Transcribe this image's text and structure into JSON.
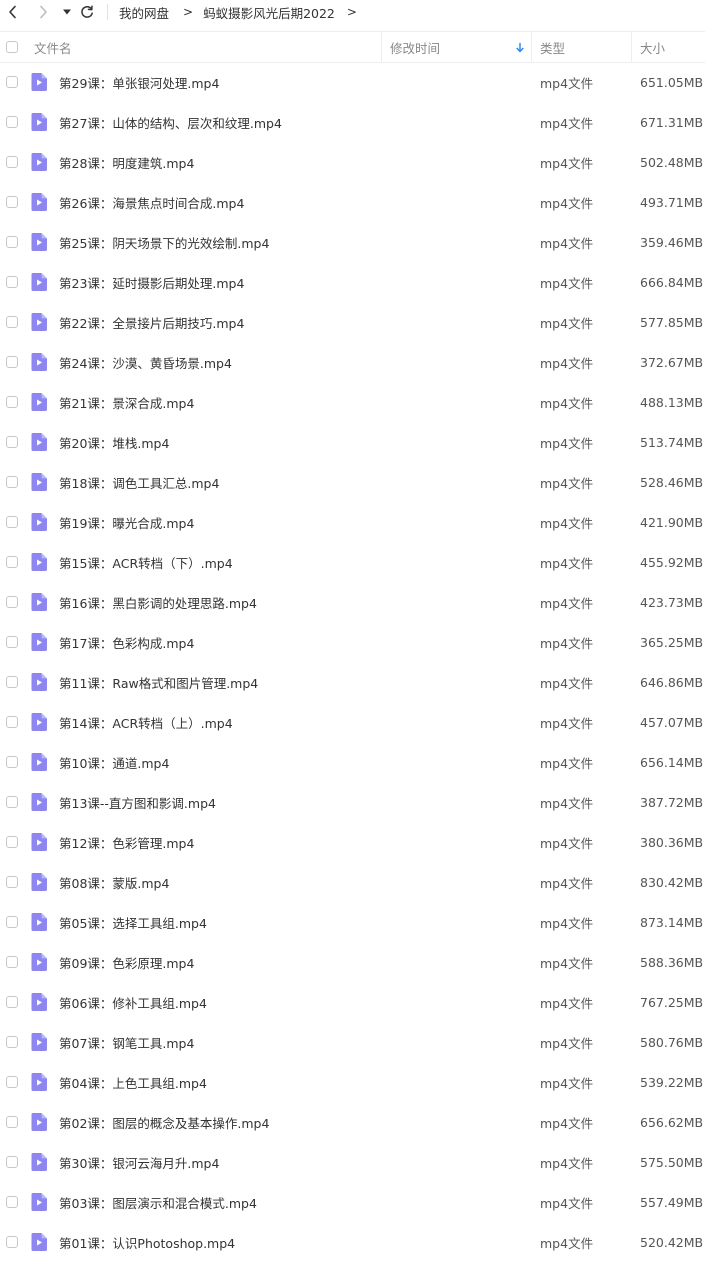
{
  "breadcrumb": {
    "root": "我的网盘",
    "current": "蚂蚁摄影风光后期2022",
    "separator": ">"
  },
  "columns": {
    "name": "文件名",
    "modified": "修改时间",
    "type": "类型",
    "size": "大小"
  },
  "colors": {
    "accent": "#2b8cf3",
    "file_icon": "#8d86f0"
  },
  "icons": {
    "back": "chevron-left-icon",
    "forward": "chevron-right-icon",
    "history": "dropdown-caret-icon",
    "refresh": "refresh-icon",
    "sort": "sort-down-arrow-icon",
    "file": "video-file-icon"
  },
  "files": [
    {
      "name": "第29课：单张银河处理.mp4",
      "type": "mp4文件",
      "size": "651.05MB"
    },
    {
      "name": "第27课：山体的结构、层次和纹理.mp4",
      "type": "mp4文件",
      "size": "671.31MB"
    },
    {
      "name": "第28课：明度建筑.mp4",
      "type": "mp4文件",
      "size": "502.48MB"
    },
    {
      "name": "第26课：海景焦点时间合成.mp4",
      "type": "mp4文件",
      "size": "493.71MB"
    },
    {
      "name": "第25课：阴天场景下的光效绘制.mp4",
      "type": "mp4文件",
      "size": "359.46MB"
    },
    {
      "name": "第23课：延时摄影后期处理.mp4",
      "type": "mp4文件",
      "size": "666.84MB"
    },
    {
      "name": "第22课：全景接片后期技巧.mp4",
      "type": "mp4文件",
      "size": "577.85MB"
    },
    {
      "name": "第24课：沙漠、黄昏场景.mp4",
      "type": "mp4文件",
      "size": "372.67MB"
    },
    {
      "name": "第21课：景深合成.mp4",
      "type": "mp4文件",
      "size": "488.13MB"
    },
    {
      "name": "第20课：堆栈.mp4",
      "type": "mp4文件",
      "size": "513.74MB"
    },
    {
      "name": "第18课：调色工具汇总.mp4",
      "type": "mp4文件",
      "size": "528.46MB"
    },
    {
      "name": "第19课：曝光合成.mp4",
      "type": "mp4文件",
      "size": "421.90MB"
    },
    {
      "name": "第15课：ACR转档（下）.mp4",
      "type": "mp4文件",
      "size": "455.92MB"
    },
    {
      "name": "第16课：黑白影调的处理思路.mp4",
      "type": "mp4文件",
      "size": "423.73MB"
    },
    {
      "name": "第17课：色彩构成.mp4",
      "type": "mp4文件",
      "size": "365.25MB"
    },
    {
      "name": "第11课：Raw格式和图片管理.mp4",
      "type": "mp4文件",
      "size": "646.86MB"
    },
    {
      "name": "第14课：ACR转档（上）.mp4",
      "type": "mp4文件",
      "size": "457.07MB"
    },
    {
      "name": "第10课：通道.mp4",
      "type": "mp4文件",
      "size": "656.14MB"
    },
    {
      "name": "第13课--直方图和影调.mp4",
      "type": "mp4文件",
      "size": "387.72MB"
    },
    {
      "name": "第12课：色彩管理.mp4",
      "type": "mp4文件",
      "size": "380.36MB"
    },
    {
      "name": "第08课：蒙版.mp4",
      "type": "mp4文件",
      "size": "830.42MB"
    },
    {
      "name": "第05课：选择工具组.mp4",
      "type": "mp4文件",
      "size": "873.14MB"
    },
    {
      "name": "第09课：色彩原理.mp4",
      "type": "mp4文件",
      "size": "588.36MB"
    },
    {
      "name": "第06课：修补工具组.mp4",
      "type": "mp4文件",
      "size": "767.25MB"
    },
    {
      "name": "第07课：钢笔工具.mp4",
      "type": "mp4文件",
      "size": "580.76MB"
    },
    {
      "name": "第04课：上色工具组.mp4",
      "type": "mp4文件",
      "size": "539.22MB"
    },
    {
      "name": "第02课：图层的概念及基本操作.mp4",
      "type": "mp4文件",
      "size": "656.62MB"
    },
    {
      "name": "第30课：银河云海月升.mp4",
      "type": "mp4文件",
      "size": "575.50MB"
    },
    {
      "name": "第03课：图层演示和混合模式.mp4",
      "type": "mp4文件",
      "size": "557.49MB"
    },
    {
      "name": "第01课：认识Photoshop.mp4",
      "type": "mp4文件",
      "size": "520.42MB"
    }
  ]
}
